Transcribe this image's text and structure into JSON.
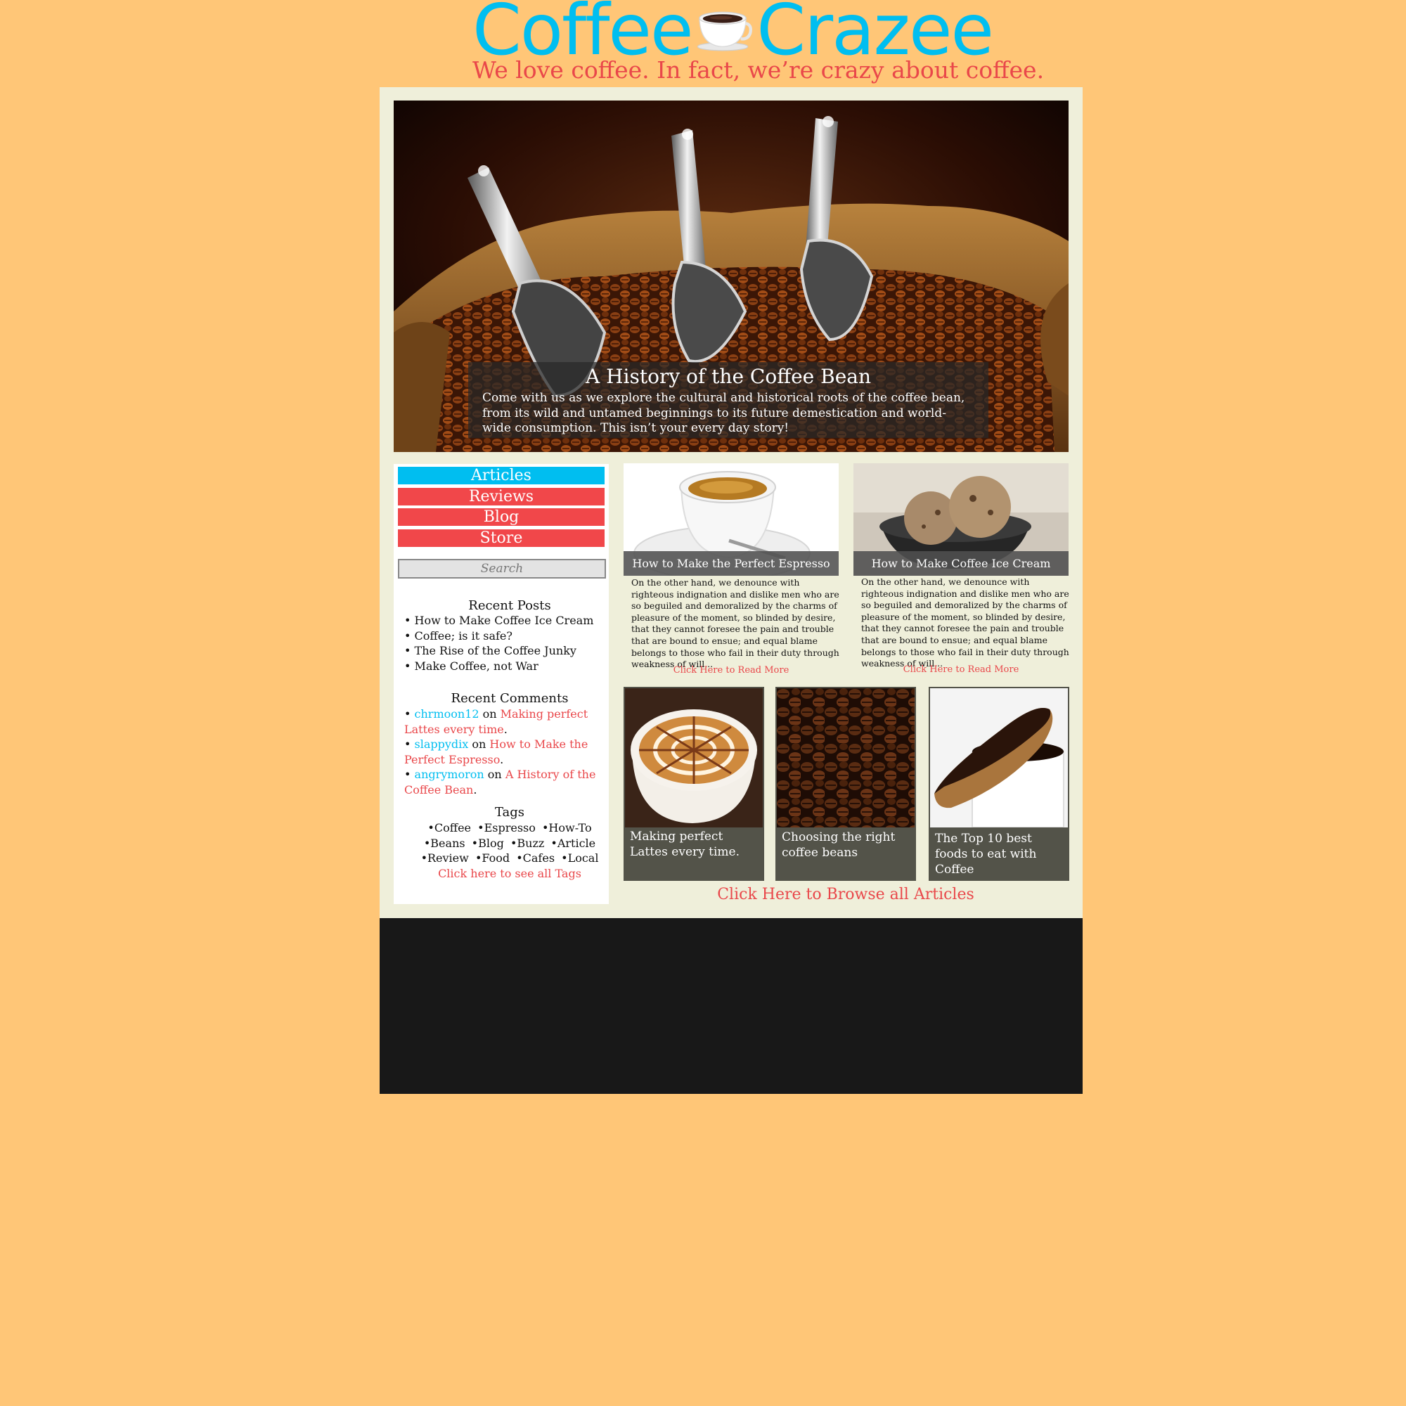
{
  "header": {
    "logo_left": "Coffee",
    "logo_right": "Crazee",
    "tagline": "We love coffee.  In fact, we’re crazy about coffee."
  },
  "hero": {
    "title": "A History of the Coffee Bean",
    "text": "Come with us as we explore the cultural and historical roots of the coffee bean, from its wild and untamed beginnings to its future demestication and world-wide consumption. This isn’t your every day story!"
  },
  "nav": {
    "articles": "Articles",
    "reviews": "Reviews",
    "blog": "Blog",
    "store": "Store"
  },
  "search": {
    "placeholder": "Search"
  },
  "recent_posts": {
    "heading": "Recent Posts",
    "items": [
      "• How to Make Coffee Ice Cream",
      "• Coffee; is it safe?",
      "• The Rise of the Coffee Junky",
      "• Make Coffee, not War"
    ]
  },
  "recent_comments": {
    "heading": "Recent Comments",
    "items": [
      {
        "bullet": "• ",
        "user": "chrmoon12",
        "on": " on ",
        "post": "Making perfect Lattes every time",
        "end": "."
      },
      {
        "bullet": "• ",
        "user": "slappydix",
        "on": " on ",
        "post": "How to Make the Perfect Espresso",
        "end": "."
      },
      {
        "bullet": "• ",
        "user": "angrymoron",
        "on": " on ",
        "post": "A History of the Coffee Bean",
        "end": "."
      }
    ]
  },
  "tags": {
    "heading": "Tags",
    "rows": [
      [
        "•Coffee",
        "•Espresso",
        "•How-To"
      ],
      [
        "•Beans",
        "•Blog",
        "•Buzz",
        "•Article"
      ],
      [
        "•Review",
        "•Food",
        "•Cafes",
        "•Local"
      ]
    ],
    "see_all": "Click here to see all Tags"
  },
  "features": [
    {
      "title": "How to Make the Perfect Espresso",
      "text": "On the other hand, we denounce with righteous indignation and dislike men who are so beguiled and demoralized by the charms of pleasure of the moment, so blinded by desire, that they cannot foresee the pain and trouble that are bound to ensue; and equal blame belongs to those who fail in their duty through weakness of will...",
      "read_more": "Click Here to Read More"
    },
    {
      "title": "How to Make Coffee Ice Cream",
      "text": "On the other hand, we denounce with righteous indignation and dislike men who are so beguiled and demoralized by the charms of pleasure of the moment, so blinded by desire, that they cannot foresee the pain and trouble that are bound to ensue; and equal blame belongs to those who fail in their duty through weakness of will...",
      "read_more": "Click Here to Read More"
    }
  ],
  "tiles": [
    {
      "text": "Making perfect Lattes every time."
    },
    {
      "text": "Choosing the right coffee beans"
    },
    {
      "text": "The Top 10 best foods to eat with Coffee"
    }
  ],
  "browse_all": "Click Here to Browse all Articles",
  "colors": {
    "background": "#ffc677",
    "accent_blue": "#00bef0",
    "accent_red": "#e9474a",
    "panel": "#efefda",
    "footer": "#181818"
  }
}
